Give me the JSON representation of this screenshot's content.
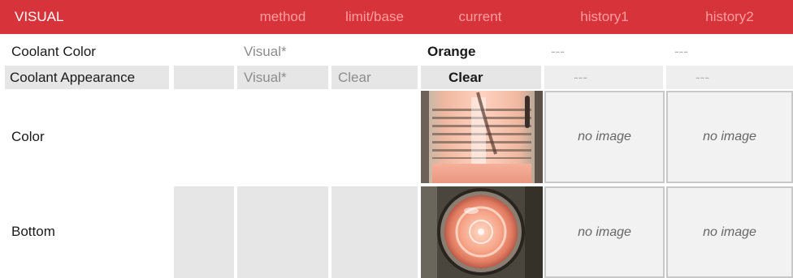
{
  "header": {
    "title": "VISUAL",
    "columns": [
      "method",
      "limit/base",
      "current",
      "history1",
      "history2"
    ]
  },
  "rows": [
    {
      "name": "Coolant Color",
      "method": "Visual*",
      "limit": "",
      "current": "Orange",
      "history1": "---",
      "history2": "---"
    },
    {
      "name": "Coolant Appearance",
      "method": "Visual*",
      "limit": "Clear",
      "current": "Clear",
      "history1": "---",
      "history2": "---"
    }
  ],
  "image_rows": [
    {
      "name": "Color",
      "history1": "no image",
      "history2": "no image",
      "photo": "coolant-jar-side-photo"
    },
    {
      "name": "Bottom",
      "history1": "no image",
      "history2": "no image",
      "photo": "coolant-jar-bottom-photo"
    }
  ],
  "colors": {
    "header_bg": "#d6343a",
    "header_text": "#ff9d9e",
    "shade": "#e6e6e6",
    "liquid": "#f4a48e"
  }
}
